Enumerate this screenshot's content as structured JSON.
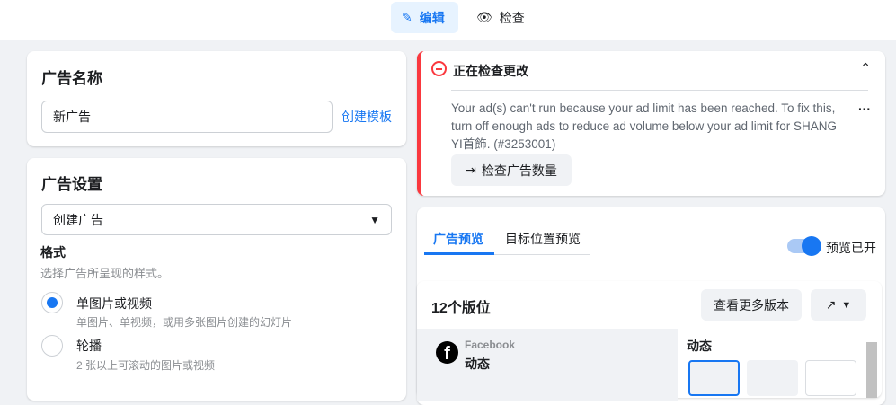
{
  "topbar": {
    "edit": "编辑",
    "review": "检查"
  },
  "ad_name": {
    "title": "广告名称",
    "value": "新广告",
    "create_template": "创建模板"
  },
  "ad_settings": {
    "title": "广告设置",
    "select": "创建广告",
    "format_label": "格式",
    "format_desc": "选择广告所呈现的样式。",
    "options": [
      {
        "label": "单图片或视频",
        "desc": "单图片、单视频，或用多张图片创建的幻灯片",
        "selected": true
      },
      {
        "label": "轮播",
        "desc": "2 张以上可滚动的图片或视频",
        "selected": false
      }
    ]
  },
  "alert": {
    "title": "正在检查更改",
    "message": "Your ad(s) can't run because your ad limit has been reached. To fix this, turn off enough ads to reduce ad volume below your ad limit for SHANG YI首飾. (#3253001)",
    "button": "检查广告数量",
    "color": "#fa383e"
  },
  "preview": {
    "tabs": [
      "广告预览",
      "目标位置预览"
    ],
    "toggle_label": "预览已开",
    "toggle_on": true,
    "placements": "12个版位",
    "more_versions": "查看更多版本",
    "platform": "Facebook",
    "placement": "动态",
    "section": "动态"
  }
}
